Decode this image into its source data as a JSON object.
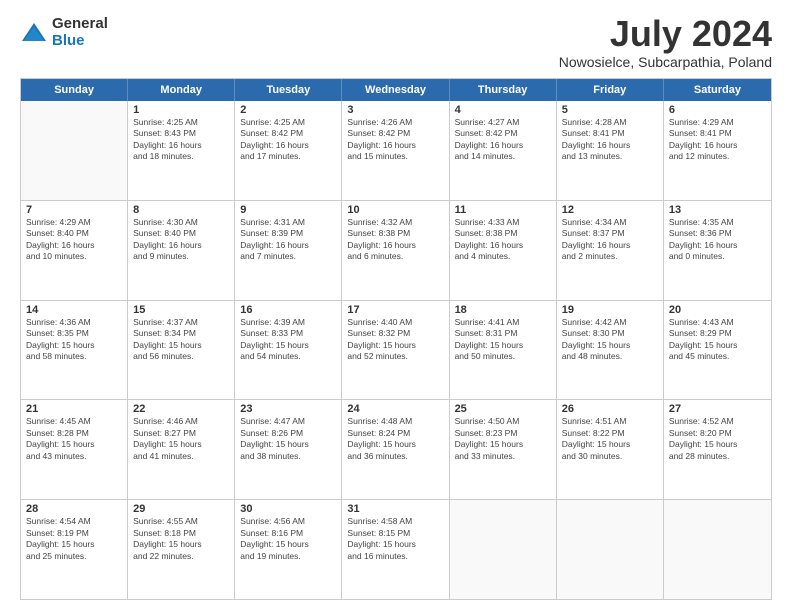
{
  "logo": {
    "general": "General",
    "blue": "Blue"
  },
  "title": "July 2024",
  "location": "Nowosielce, Subcarpathia, Poland",
  "days_of_week": [
    "Sunday",
    "Monday",
    "Tuesday",
    "Wednesday",
    "Thursday",
    "Friday",
    "Saturday"
  ],
  "weeks": [
    [
      {
        "day": "",
        "text": ""
      },
      {
        "day": "1",
        "text": "Sunrise: 4:25 AM\nSunset: 8:43 PM\nDaylight: 16 hours\nand 18 minutes."
      },
      {
        "day": "2",
        "text": "Sunrise: 4:25 AM\nSunset: 8:42 PM\nDaylight: 16 hours\nand 17 minutes."
      },
      {
        "day": "3",
        "text": "Sunrise: 4:26 AM\nSunset: 8:42 PM\nDaylight: 16 hours\nand 15 minutes."
      },
      {
        "day": "4",
        "text": "Sunrise: 4:27 AM\nSunset: 8:42 PM\nDaylight: 16 hours\nand 14 minutes."
      },
      {
        "day": "5",
        "text": "Sunrise: 4:28 AM\nSunset: 8:41 PM\nDaylight: 16 hours\nand 13 minutes."
      },
      {
        "day": "6",
        "text": "Sunrise: 4:29 AM\nSunset: 8:41 PM\nDaylight: 16 hours\nand 12 minutes."
      }
    ],
    [
      {
        "day": "7",
        "text": "Sunrise: 4:29 AM\nSunset: 8:40 PM\nDaylight: 16 hours\nand 10 minutes."
      },
      {
        "day": "8",
        "text": "Sunrise: 4:30 AM\nSunset: 8:40 PM\nDaylight: 16 hours\nand 9 minutes."
      },
      {
        "day": "9",
        "text": "Sunrise: 4:31 AM\nSunset: 8:39 PM\nDaylight: 16 hours\nand 7 minutes."
      },
      {
        "day": "10",
        "text": "Sunrise: 4:32 AM\nSunset: 8:38 PM\nDaylight: 16 hours\nand 6 minutes."
      },
      {
        "day": "11",
        "text": "Sunrise: 4:33 AM\nSunset: 8:38 PM\nDaylight: 16 hours\nand 4 minutes."
      },
      {
        "day": "12",
        "text": "Sunrise: 4:34 AM\nSunset: 8:37 PM\nDaylight: 16 hours\nand 2 minutes."
      },
      {
        "day": "13",
        "text": "Sunrise: 4:35 AM\nSunset: 8:36 PM\nDaylight: 16 hours\nand 0 minutes."
      }
    ],
    [
      {
        "day": "14",
        "text": "Sunrise: 4:36 AM\nSunset: 8:35 PM\nDaylight: 15 hours\nand 58 minutes."
      },
      {
        "day": "15",
        "text": "Sunrise: 4:37 AM\nSunset: 8:34 PM\nDaylight: 15 hours\nand 56 minutes."
      },
      {
        "day": "16",
        "text": "Sunrise: 4:39 AM\nSunset: 8:33 PM\nDaylight: 15 hours\nand 54 minutes."
      },
      {
        "day": "17",
        "text": "Sunrise: 4:40 AM\nSunset: 8:32 PM\nDaylight: 15 hours\nand 52 minutes."
      },
      {
        "day": "18",
        "text": "Sunrise: 4:41 AM\nSunset: 8:31 PM\nDaylight: 15 hours\nand 50 minutes."
      },
      {
        "day": "19",
        "text": "Sunrise: 4:42 AM\nSunset: 8:30 PM\nDaylight: 15 hours\nand 48 minutes."
      },
      {
        "day": "20",
        "text": "Sunrise: 4:43 AM\nSunset: 8:29 PM\nDaylight: 15 hours\nand 45 minutes."
      }
    ],
    [
      {
        "day": "21",
        "text": "Sunrise: 4:45 AM\nSunset: 8:28 PM\nDaylight: 15 hours\nand 43 minutes."
      },
      {
        "day": "22",
        "text": "Sunrise: 4:46 AM\nSunset: 8:27 PM\nDaylight: 15 hours\nand 41 minutes."
      },
      {
        "day": "23",
        "text": "Sunrise: 4:47 AM\nSunset: 8:26 PM\nDaylight: 15 hours\nand 38 minutes."
      },
      {
        "day": "24",
        "text": "Sunrise: 4:48 AM\nSunset: 8:24 PM\nDaylight: 15 hours\nand 36 minutes."
      },
      {
        "day": "25",
        "text": "Sunrise: 4:50 AM\nSunset: 8:23 PM\nDaylight: 15 hours\nand 33 minutes."
      },
      {
        "day": "26",
        "text": "Sunrise: 4:51 AM\nSunset: 8:22 PM\nDaylight: 15 hours\nand 30 minutes."
      },
      {
        "day": "27",
        "text": "Sunrise: 4:52 AM\nSunset: 8:20 PM\nDaylight: 15 hours\nand 28 minutes."
      }
    ],
    [
      {
        "day": "28",
        "text": "Sunrise: 4:54 AM\nSunset: 8:19 PM\nDaylight: 15 hours\nand 25 minutes."
      },
      {
        "day": "29",
        "text": "Sunrise: 4:55 AM\nSunset: 8:18 PM\nDaylight: 15 hours\nand 22 minutes."
      },
      {
        "day": "30",
        "text": "Sunrise: 4:56 AM\nSunset: 8:16 PM\nDaylight: 15 hours\nand 19 minutes."
      },
      {
        "day": "31",
        "text": "Sunrise: 4:58 AM\nSunset: 8:15 PM\nDaylight: 15 hours\nand 16 minutes."
      },
      {
        "day": "",
        "text": ""
      },
      {
        "day": "",
        "text": ""
      },
      {
        "day": "",
        "text": ""
      }
    ]
  ]
}
